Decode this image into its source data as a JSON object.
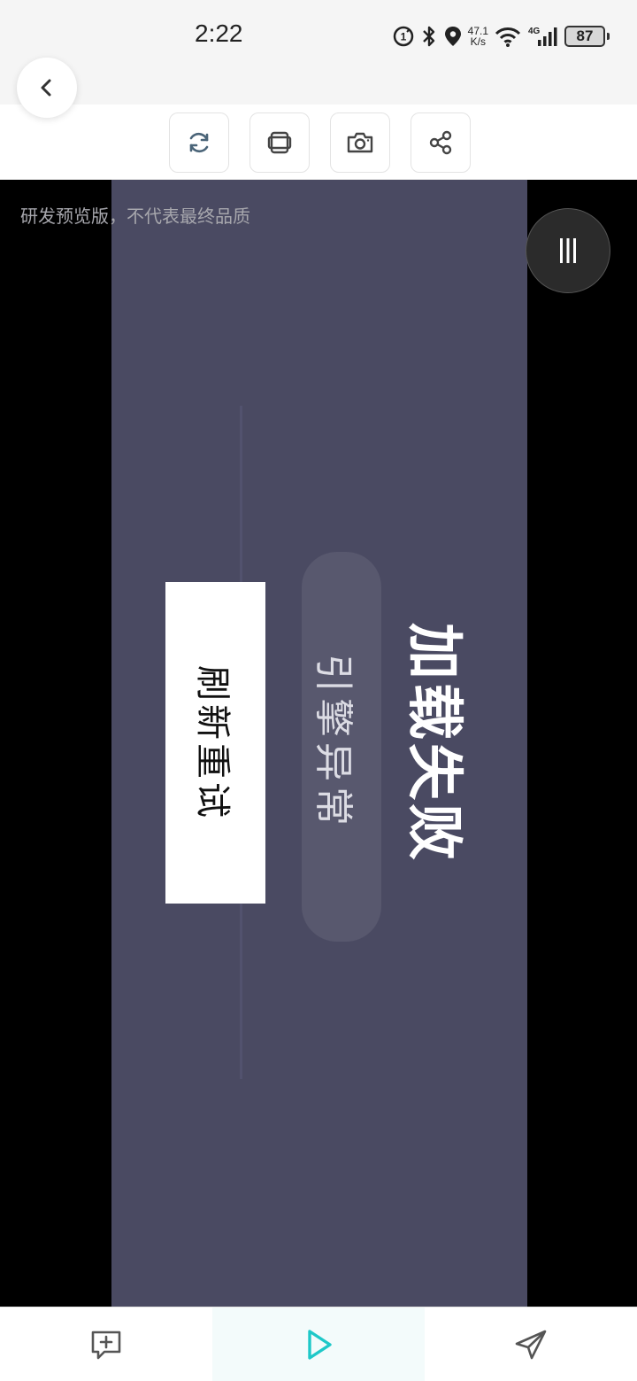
{
  "status_bar": {
    "time": "2:22",
    "net_speed_value": "47.1",
    "net_speed_unit": "K/s",
    "signal_label": "4G",
    "battery": "87"
  },
  "toolbar": {
    "buttons": [
      {
        "icon": "refresh-icon"
      },
      {
        "icon": "rotate-screen-icon"
      },
      {
        "icon": "camera-icon"
      },
      {
        "icon": "share-icon"
      }
    ]
  },
  "game": {
    "preview_note": "研发预览版，不代表最终品质",
    "title": "加载失败",
    "subtitle": "引擎异常",
    "retry_label": "刷新重试"
  },
  "colors": {
    "panel": "#4a4a62",
    "accent": "#1ec8c8"
  },
  "bottom_nav": {
    "items": [
      {
        "icon": "comment-add-icon"
      },
      {
        "icon": "play-icon",
        "active": true
      },
      {
        "icon": "send-icon"
      }
    ]
  }
}
